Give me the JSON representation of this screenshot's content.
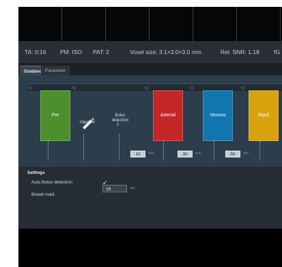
{
  "info": {
    "ta": "TA: 0:16",
    "pm": "PM: ISO",
    "pat": "PAT: 2",
    "voxel": "Voxel size: 3.1×3.0×3.0 mm",
    "snr": "Rel. SNR: 1.18",
    "cut": "fG"
  },
  "tabs": [
    {
      "label": "Guidance"
    },
    {
      "label": "Parameter"
    }
  ],
  "phases": [
    {
      "label": "Pre",
      "color": "#4d8f2c"
    },
    {
      "label": "Arterial",
      "color": "#c4262a"
    },
    {
      "label": "Venous",
      "color": "#0f76ae"
    },
    {
      "label": "Equil",
      "color": "#d9a20f"
    }
  ],
  "annotations": {
    "injection": "Injection",
    "bolus_detection_line1": "Bolus",
    "bolus_detection_line2": "detection"
  },
  "delays": [
    {
      "value": "10",
      "unit": "sec"
    },
    {
      "value": "30",
      "unit": "sec"
    },
    {
      "value": "50",
      "unit": "sec"
    }
  ],
  "settings": {
    "title": "Settings",
    "auto_bolus_label": "Auto Bolus detection:",
    "auto_bolus_checked": "✓",
    "breath_hold_label": "Breath hold:",
    "breath_hold_value": "16",
    "breath_hold_unit": "sec"
  },
  "icons": {
    "syringe": "syringe-icon",
    "arrow": "arrow-down-icon"
  }
}
